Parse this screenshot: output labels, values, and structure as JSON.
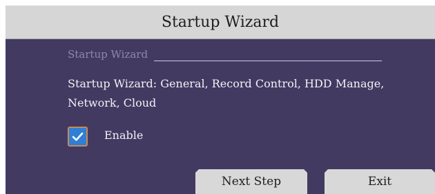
{
  "window": {
    "title": "Startup Wizard"
  },
  "section": {
    "title": "Startup Wizard"
  },
  "description": "Startup Wizard: General, Record Control, HDD Manage, Network, Cloud",
  "enable": {
    "label": "Enable",
    "checked": true
  },
  "buttons": {
    "next": "Next Step",
    "exit": "Exit"
  },
  "colors": {
    "panel_bg": "#433a62",
    "titlebar_bg": "#d6d6d6",
    "checkbox_fill": "#2f7fd6",
    "checkbox_border": "#c98a5a",
    "button_bg": "#d8d8d8"
  },
  "icons": {
    "checkbox_mark": "checkmark-icon"
  }
}
